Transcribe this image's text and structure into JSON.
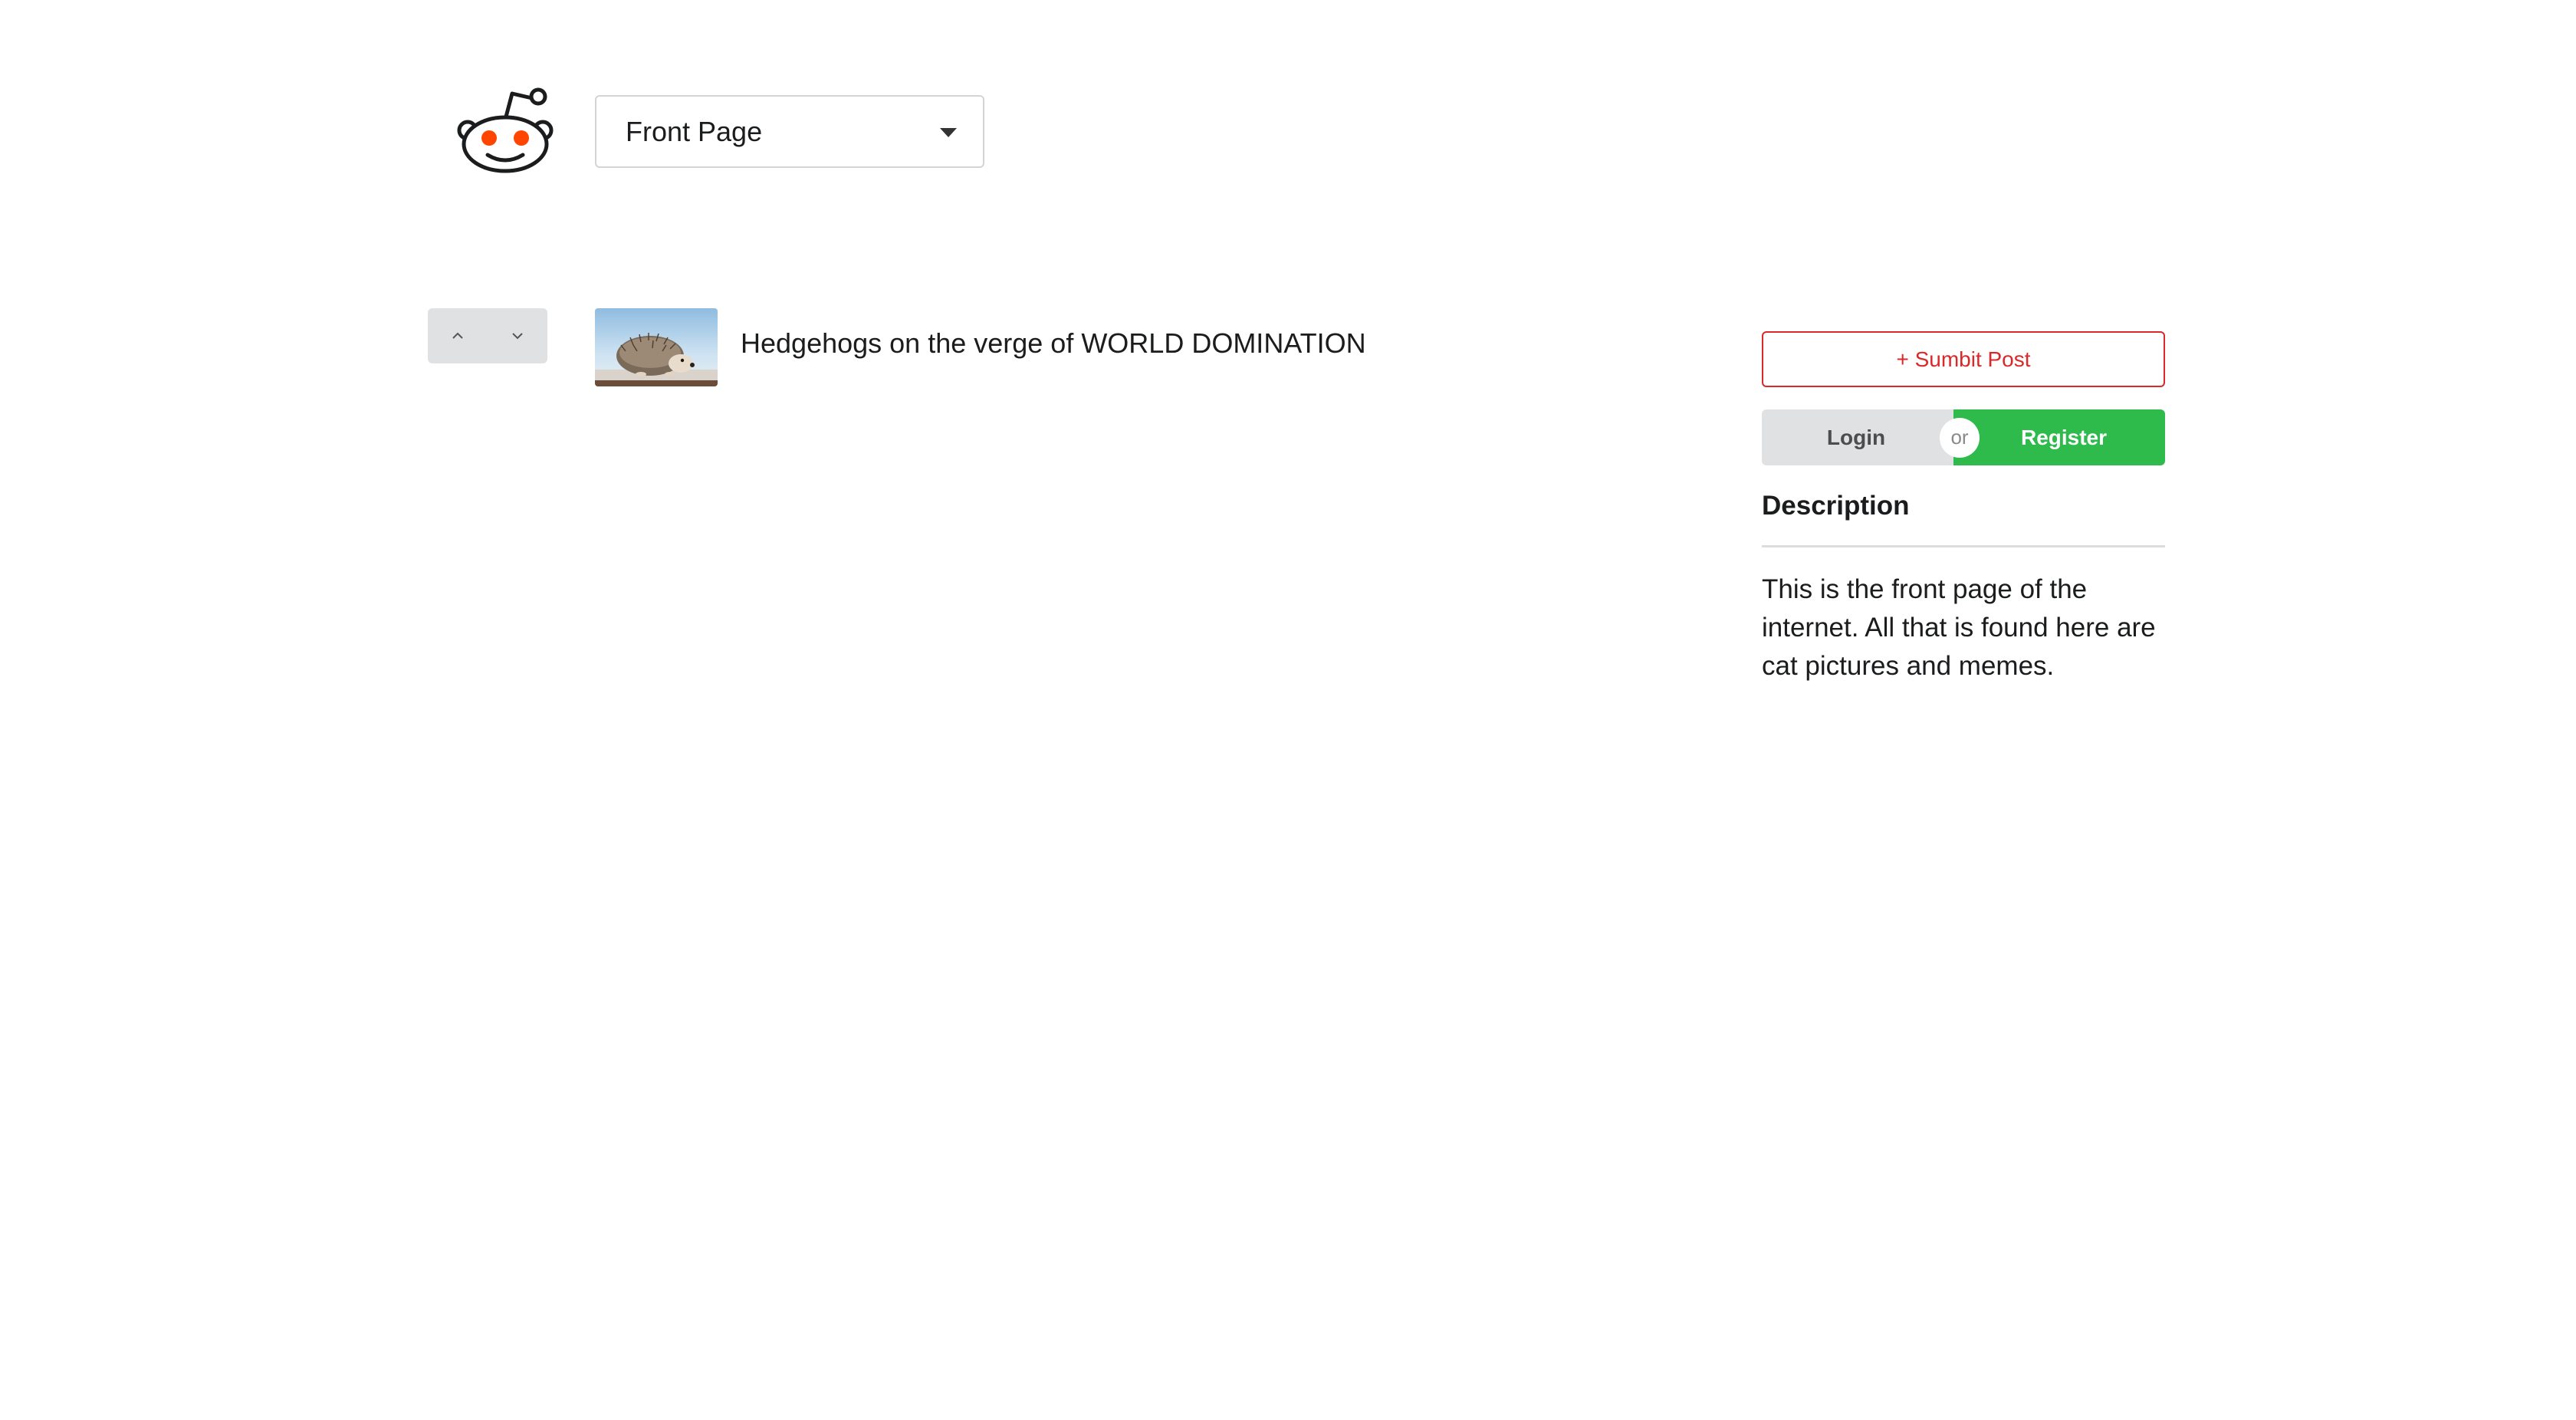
{
  "header": {
    "logo_icon": "reddit-alien-icon",
    "dropdown": {
      "selected": "Front Page",
      "caret_icon": "caret-down-icon"
    }
  },
  "posts": [
    {
      "title": "Hedgehogs on the verge of WORLD DOMINATION",
      "thumbnail_icon": "hedgehog-thumbnail",
      "upvote_icon": "chevron-up-icon",
      "downvote_icon": "chevron-down-icon"
    }
  ],
  "sidebar": {
    "submit_label": "+ Sumbit Post",
    "login_label": "Login",
    "or_label": "or",
    "register_label": "Register",
    "description_heading": "Description",
    "description_text": "This is the front page of the internet. All that is found here are cat pictures and memes."
  },
  "colors": {
    "accent_red": "#db2828",
    "register_green": "#2fba4c",
    "logo_eyes": "#ff4500",
    "button_grey": "#e0e1e2"
  }
}
